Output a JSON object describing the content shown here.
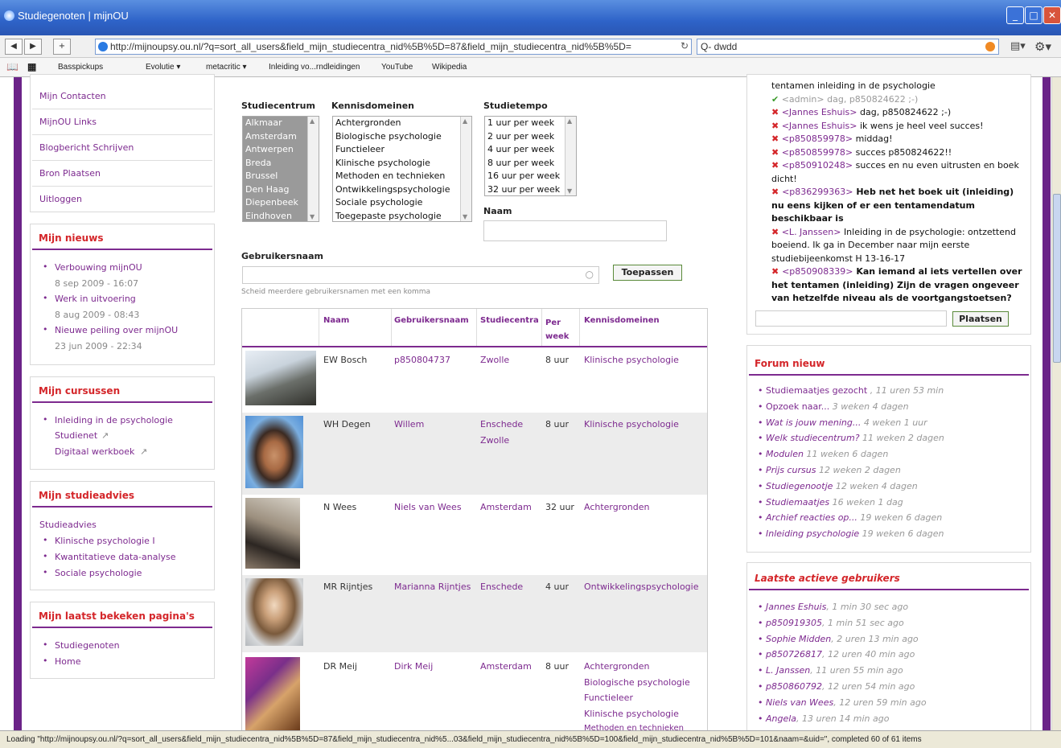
{
  "window": {
    "title": "Studiegenoten | mijnOU",
    "url": "http://mijnoupsy.ou.nl/?q=sort_all_users&field_mijn_studiecentra_nid%5B%5D=87&field_mijn_studiecentra_nid%5B%5D=",
    "search_value": "Q- dwdd",
    "status": "Loading \"http://mijnoupsy.ou.nl/?q=sort_all_users&field_mijn_studiecentra_nid%5B%5D=87&field_mijn_studiecentra_nid%5...03&field_mijn_studiecentra_nid%5B%5D=100&field_mijn_studiecentra_nid%5B%5D=101&naam=&uid=\", completed 60 of 61 items"
  },
  "bookmarks": [
    "Basspickups",
    "Evolutie ▾",
    "metacritic ▾",
    "Inleiding vo...rndleidingen",
    "YouTube",
    "Wikipedia"
  ],
  "left_nav": {
    "menu": [
      "Mijn Contacten",
      "MijnOU Links",
      "Blogbericht Schrijven",
      "Bron Plaatsen",
      "Uitloggen"
    ],
    "nieuws": {
      "title": "Mijn nieuws",
      "items": [
        {
          "label": "Verbouwing mijnOU",
          "date": "8 sep 2009 - 16:07"
        },
        {
          "label": "Werk in uitvoering",
          "date": "8 aug 2009 - 08:43"
        },
        {
          "label": "Nieuwe peiling over mijnOU",
          "date": "23 jun 2009 - 22:34"
        }
      ]
    },
    "cursussen": {
      "title": "Mijn cursussen",
      "course": "Inleiding in de psychologie",
      "links": [
        "Studienet",
        "Digitaal werkboek"
      ]
    },
    "studieadvies": {
      "title": "Mijn studieadvies",
      "label": "Studieadvies",
      "items": [
        "Klinische psychologie I",
        "Kwantitatieve data-analyse",
        "Sociale psychologie"
      ]
    },
    "laatst": {
      "title": "Mijn laatst bekeken pagina's",
      "items": [
        "Studiegenoten",
        "Home"
      ]
    }
  },
  "filters": {
    "studiecentrum": {
      "label": "Studiecentrum",
      "options": [
        "Alkmaar",
        "Amsterdam",
        "Antwerpen",
        "Breda",
        "Brussel",
        "Den Haag",
        "Diepenbeek",
        "Eindhoven"
      ]
    },
    "kennisdomeinen": {
      "label": "Kennisdomeinen",
      "options": [
        "Achtergronden",
        "Biologische psychologie",
        "Functieleer",
        "Klinische psychologie",
        "Methoden en technieken",
        "Ontwikkelingspsychologie",
        "Sociale psychologie",
        "Toegepaste psychologie"
      ]
    },
    "studietempo": {
      "label": "Studietempo",
      "options": [
        "1 uur per week",
        "2 uur per week",
        "4 uur per week",
        "8 uur per week",
        "16 uur per week",
        "32 uur per week"
      ]
    },
    "naam_label": "Naam",
    "gebruikersnaam_label": "Gebruikersnaam",
    "hint": "Scheid meerdere gebruikersnamen met een komma",
    "apply": "Toepassen"
  },
  "table": {
    "headers": [
      "Naam",
      "Gebruikersnaam",
      "Studiecentra",
      "Per week",
      "Kennisdomeinen"
    ],
    "rows": [
      {
        "naam": "EW Bosch",
        "gebruiker": "p850804737",
        "centra": [
          "Zwolle"
        ],
        "per_week": "8 uur",
        "domeinen": [
          "Klinische psychologie"
        ]
      },
      {
        "naam": "WH Degen",
        "gebruiker": "Willem",
        "centra": [
          "Enschede",
          "Zwolle"
        ],
        "per_week": "8 uur",
        "domeinen": [
          "Klinische psychologie"
        ]
      },
      {
        "naam": "N Wees",
        "gebruiker": "Niels van Wees",
        "centra": [
          "Amsterdam"
        ],
        "per_week": "32 uur",
        "domeinen": [
          "Achtergronden"
        ]
      },
      {
        "naam": "MR Rijntjes",
        "gebruiker": "Marianna Rijntjes",
        "centra": [
          "Enschede"
        ],
        "per_week": "4 uur",
        "domeinen": [
          "Ontwikkelingspsychologie"
        ]
      },
      {
        "naam": "DR Meij",
        "gebruiker": "Dirk Meij",
        "centra": [
          "Amsterdam"
        ],
        "per_week": "8 uur",
        "domeinen": [
          "Achtergronden",
          "Biologische psychologie",
          "Functieleer",
          "Klinische psychologie",
          "Methoden en technieken"
        ]
      }
    ]
  },
  "chat": {
    "messages": [
      {
        "mark": "",
        "user": "",
        "text": "tentamen inleiding in de psychologie",
        "style": "normal"
      },
      {
        "mark": "ok",
        "user": "<admin>",
        "text": "dag, p850824622 ;-)",
        "style": "gray"
      },
      {
        "mark": "x",
        "user": "<Jannes Eshuis>",
        "text": "dag, p850824622 ;-)",
        "style": "normal"
      },
      {
        "mark": "x",
        "user": "<Jannes Eshuis>",
        "text": "ik wens je heel veel succes!",
        "style": "normal"
      },
      {
        "mark": "x",
        "user": "<p850859978>",
        "text": "middag!",
        "style": "normal"
      },
      {
        "mark": "x",
        "user": "<p850859978>",
        "text": "succes p850824622!!",
        "style": "normal"
      },
      {
        "mark": "x",
        "user": "<p850910248>",
        "text": "succes en nu even uitrusten en boek dicht!",
        "style": "normal"
      },
      {
        "mark": "x",
        "user": "<p836299363>",
        "text": "Heb net het boek uit (inleiding) nu eens kijken of er een tentamendatum beschikbaar is",
        "style": "bold"
      },
      {
        "mark": "x",
        "user": "<L. Janssen>",
        "text": "Inleiding in de psychologie: ontzettend boeiend. Ik ga in December naar mijn eerste studiebijeenkomst H 13-16-17",
        "style": "normal"
      },
      {
        "mark": "x",
        "user": "<p850908339>",
        "text": "Kan iemand al iets vertellen over het tentamen (inleiding) Zijn de vragen ongeveer van hetzelfde niveau als de voortgangstoetsen?",
        "style": "bold"
      }
    ],
    "send": "Plaatsen"
  },
  "forum": {
    "title": "Forum nieuw",
    "items": [
      {
        "label": "Studiemaatjes gezocht",
        "time": ", 11 uren 53 min"
      },
      {
        "label": "Opzoek naar...",
        "time": "3 weken 4 dagen"
      },
      {
        "label": "Wat is jouw mening...",
        "time": "4 weken 1 uur"
      },
      {
        "label": "Welk studiecentrum?",
        "time": "11 weken 2 dagen"
      },
      {
        "label": "Modulen",
        "time": "11 weken 6 dagen"
      },
      {
        "label": "Prijs cursus",
        "time": "12 weken 2 dagen"
      },
      {
        "label": "Studiegenootje",
        "time": "12 weken 4 dagen"
      },
      {
        "label": "Studiemaatjes",
        "time": "16 weken 1 dag"
      },
      {
        "label": "Archief reacties op...",
        "time": "19 weken 6 dagen"
      },
      {
        "label": "Inleiding psychologie",
        "time": "19 weken 6 dagen"
      }
    ]
  },
  "actieve": {
    "title": "Laatste actieve gebruikers",
    "items": [
      {
        "label": "Jannes Eshuis",
        "time": ", 1 min 30 sec ago"
      },
      {
        "label": "p850919305",
        "time": ", 1 min 51 sec ago"
      },
      {
        "label": "Sophie Midden",
        "time": ", 2 uren 13 min ago"
      },
      {
        "label": "p850726817",
        "time": ", 12 uren 40 min ago"
      },
      {
        "label": "L. Janssen",
        "time": ", 11 uren 55 min ago"
      },
      {
        "label": "p850860792",
        "time": ", 12 uren 54 min ago"
      },
      {
        "label": "Niels van Wees",
        "time": ", 12 uren 59 min ago"
      },
      {
        "label": "Angela",
        "time": ", 13 uren 14 min ago"
      }
    ]
  }
}
